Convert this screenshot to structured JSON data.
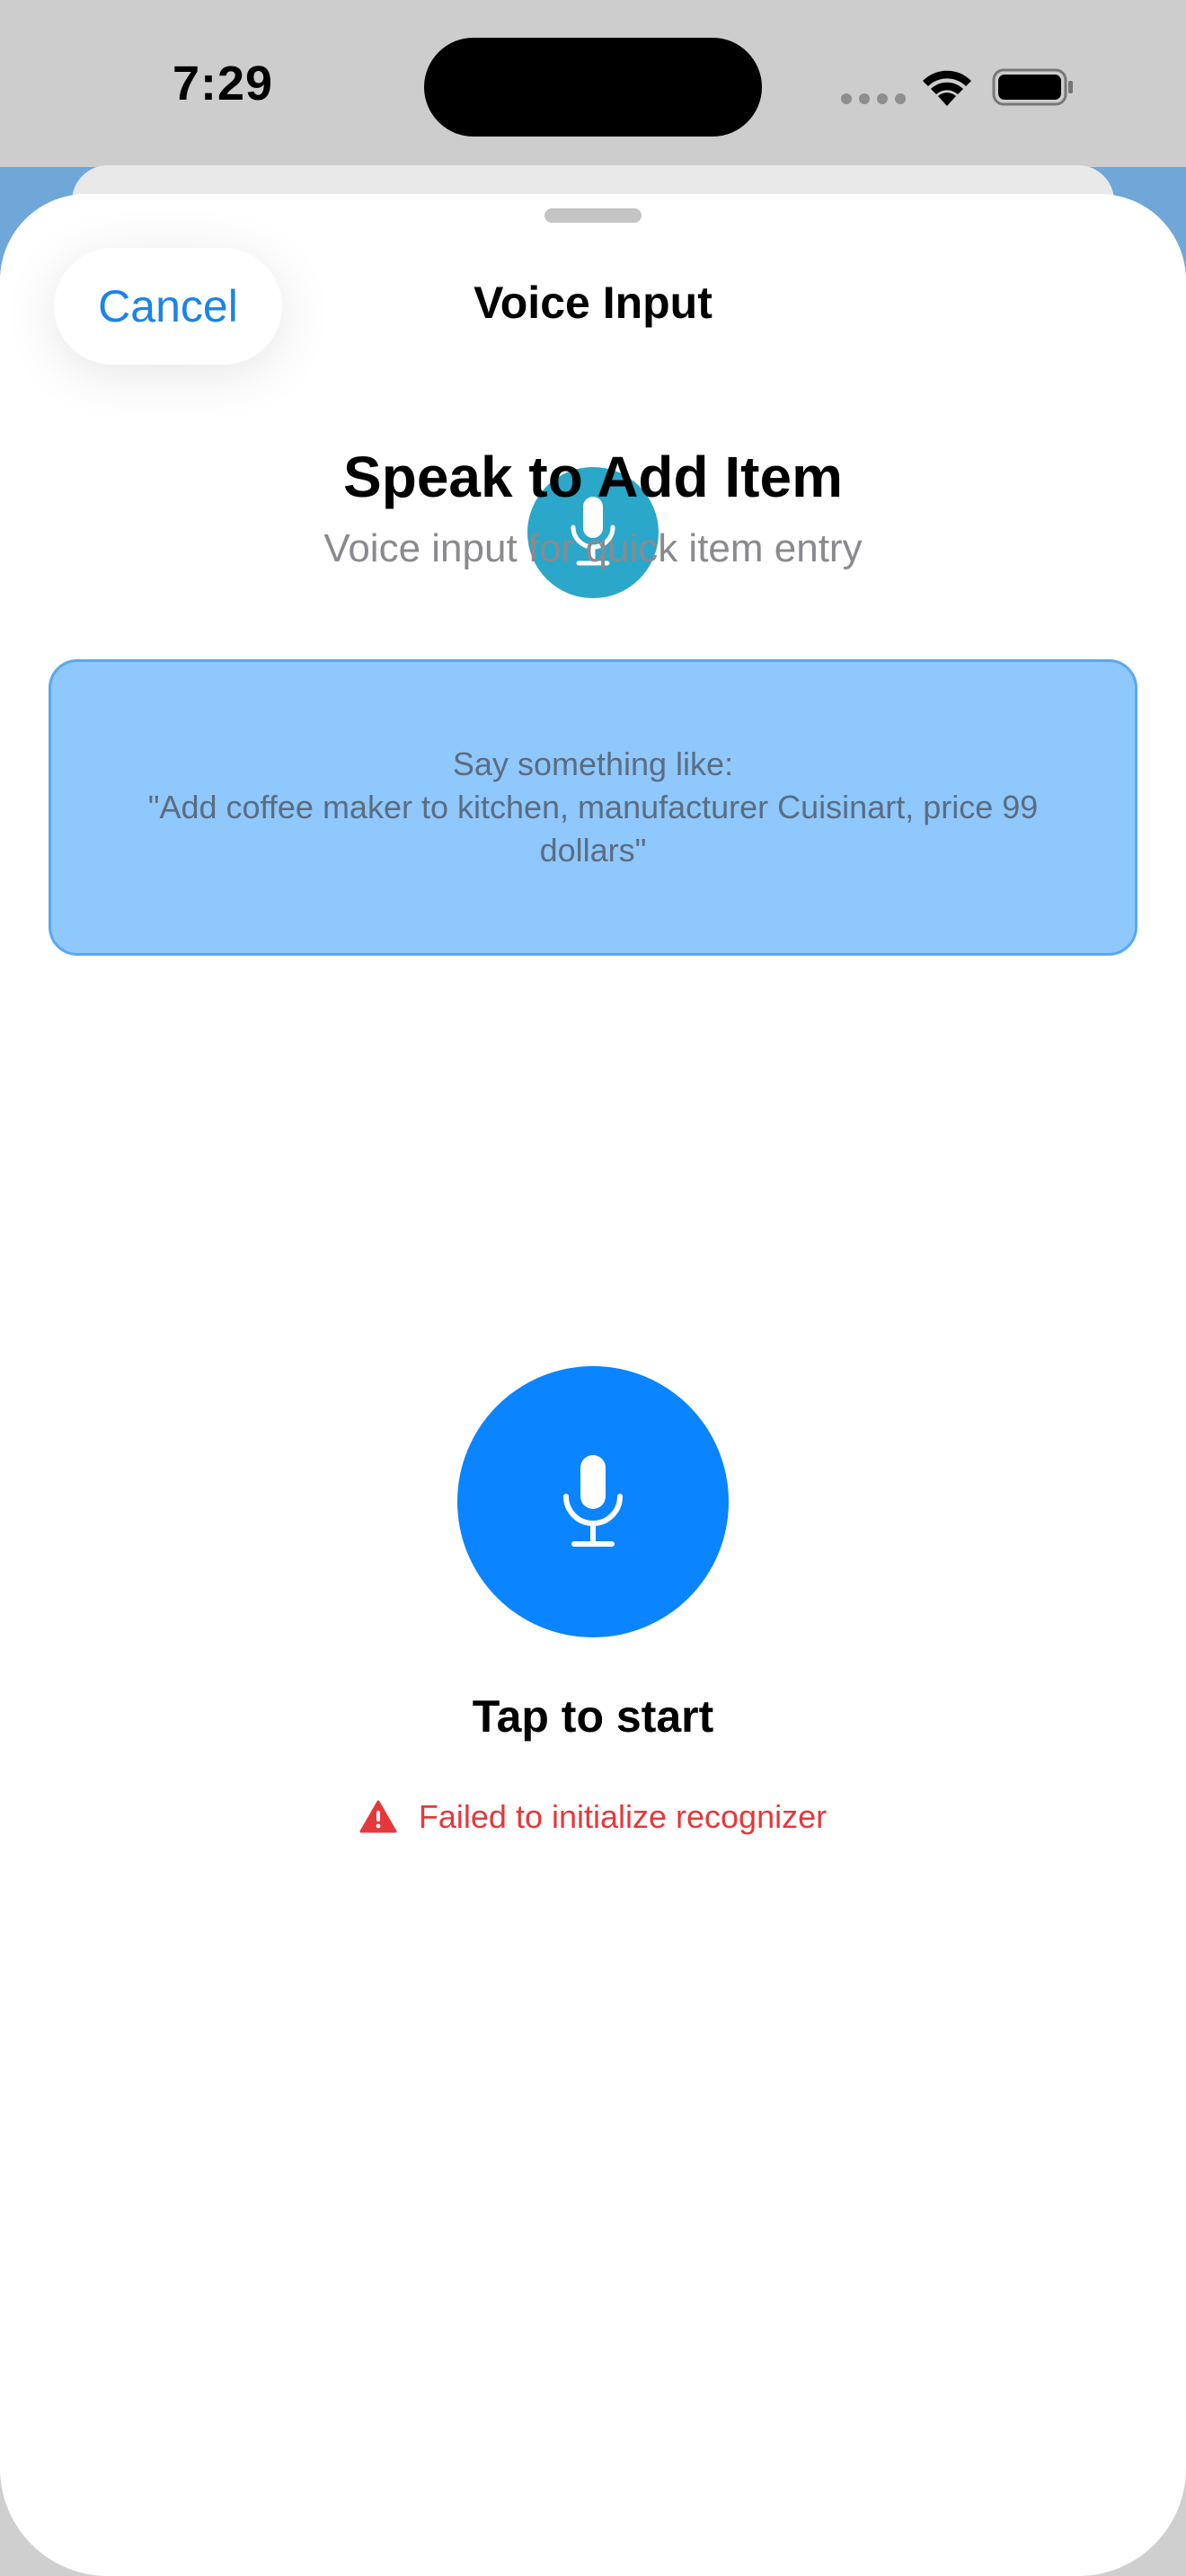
{
  "status_bar": {
    "time": "7:29"
  },
  "nav": {
    "cancel_label": "Cancel",
    "title": "Voice Input"
  },
  "header": {
    "icon": "microphone-icon",
    "title": "Speak to Add Item",
    "subtitle": "Voice input for quick item entry"
  },
  "example": {
    "line1": "Say something like:",
    "line2": "\"Add coffee maker to kitchen, manufacturer Cuisinart, price 99 dollars\""
  },
  "record": {
    "icon": "microphone-icon",
    "label": "Tap to start"
  },
  "error": {
    "icon": "warning-triangle-icon",
    "message": "Failed to initialize recognizer"
  },
  "colors": {
    "accent": "#0a84ff",
    "cancel_text": "#1a84e8",
    "small_mic_bg": "#2aa7c9",
    "example_bg": "#8ec8fd",
    "error": "#e5383b"
  }
}
